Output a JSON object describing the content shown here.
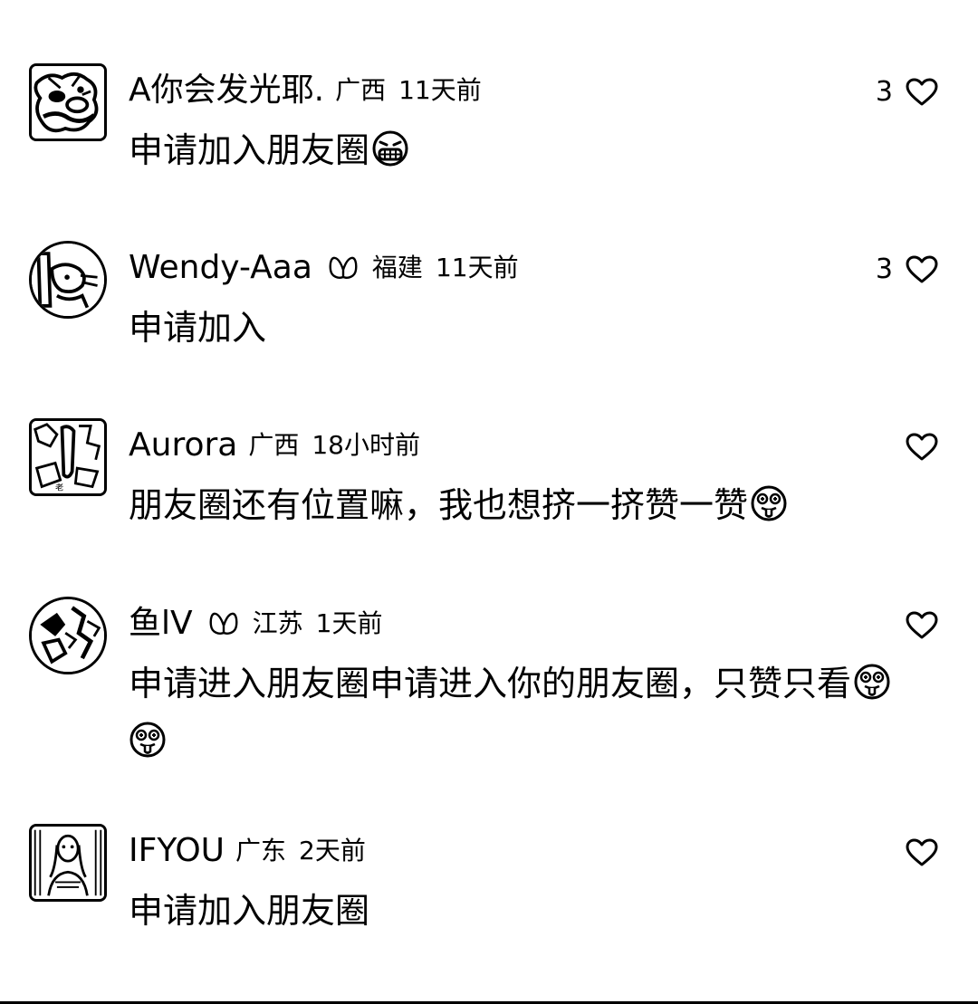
{
  "comments": [
    {
      "username": "A你会发光耶.",
      "badge": false,
      "location": "广西",
      "time": "11天前",
      "text": "申请加入朋友圈",
      "emoji": "grimace-emoji",
      "likes": "3",
      "avatar_shape": "square"
    },
    {
      "username": "Wendy-Aaa",
      "badge": true,
      "location": "福建",
      "time": "11天前",
      "text": "申请加入",
      "emoji": "",
      "likes": "3",
      "avatar_shape": "round"
    },
    {
      "username": "Aurora",
      "badge": false,
      "location": "广西",
      "time": "18小时前",
      "text": "朋友圈还有位置嘛，我也想挤一挤赞一赞",
      "emoji": "goofy-emoji",
      "likes": "",
      "avatar_shape": "square"
    },
    {
      "username": "鱼lV",
      "badge": true,
      "location": "江苏",
      "time": "1天前",
      "text": "申请进入朋友圈申请进入你的朋友圈，只赞只看",
      "emoji": "goofy-emoji",
      "likes": "",
      "avatar_shape": "round"
    },
    {
      "username": "IFYOU",
      "badge": false,
      "location": "广东",
      "time": "2天前",
      "text": "申请加入朋友圈",
      "emoji": "",
      "likes": "",
      "avatar_shape": "square"
    }
  ],
  "icons": {
    "like": "heart-icon",
    "badge": "butterfly-icon"
  }
}
